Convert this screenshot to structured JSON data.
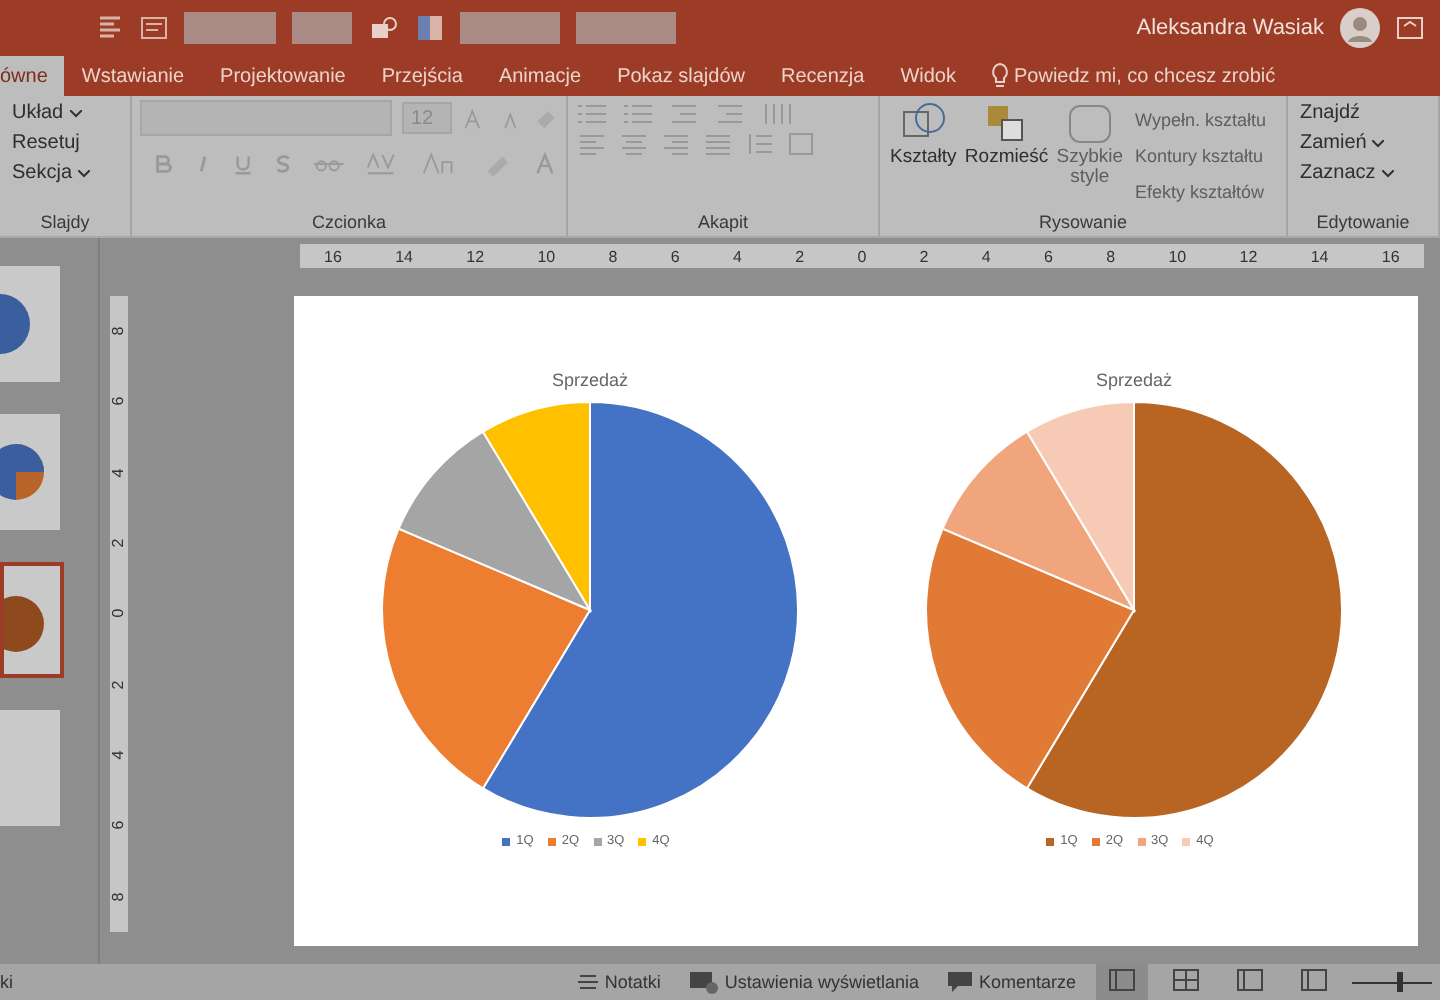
{
  "title_bar": {
    "user": "Aleksandra Wasiak"
  },
  "tabs": [
    {
      "label": "ówne",
      "selected": true
    },
    {
      "label": "Wstawianie",
      "selected": false
    },
    {
      "label": "Projektowanie",
      "selected": false
    },
    {
      "label": "Przejścia",
      "selected": false
    },
    {
      "label": "Animacje",
      "selected": false
    },
    {
      "label": "Pokaz slajdów",
      "selected": false
    },
    {
      "label": "Recenzja",
      "selected": false
    },
    {
      "label": "Widok",
      "selected": false
    }
  ],
  "tell_me": {
    "placeholder": "Powiedz mi, co chcesz zrobić"
  },
  "ribbon": {
    "slides": {
      "items": [
        {
          "label": "Układ",
          "caret": true
        },
        {
          "label": "Resetuj",
          "caret": false
        },
        {
          "label": "Sekcja",
          "caret": true
        }
      ],
      "label": "Slajdy"
    },
    "font": {
      "size": "12",
      "label": "Czcionka"
    },
    "paragraph": {
      "label": "Akapit"
    },
    "drawing": {
      "big": [
        {
          "label": "Kształty",
          "disabled": false
        },
        {
          "label": "Rozmieść",
          "disabled": false
        },
        {
          "label": "Szybkie style",
          "disabled": true
        }
      ],
      "small": [
        {
          "label": "Wypełn. kształtu",
          "disabled": true
        },
        {
          "label": "Kontury kształtu",
          "disabled": true
        },
        {
          "label": "Efekty kształtów",
          "disabled": true
        }
      ],
      "label": "Rysowanie"
    },
    "editing": {
      "items": [
        {
          "label": "Znajdź",
          "caret": false
        },
        {
          "label": "Zamień",
          "caret": true
        },
        {
          "label": "Zaznacz",
          "caret": true
        }
      ],
      "label": "Edytowanie"
    }
  },
  "ruler": {
    "horizontal": [
      "16",
      "14",
      "12",
      "10",
      "8",
      "6",
      "4",
      "2",
      "0",
      "2",
      "4",
      "6",
      "8",
      "10",
      "12",
      "14",
      "16"
    ],
    "vertical": [
      "8",
      "6",
      "4",
      "2",
      "0",
      "2",
      "4",
      "6",
      "8"
    ]
  },
  "thumbnails": [
    {
      "kind": "blue",
      "selected": false
    },
    {
      "kind": "half",
      "selected": false
    },
    {
      "kind": "brown",
      "selected": true
    },
    {
      "kind": "blank",
      "selected": false
    }
  ],
  "charts": [
    {
      "chart_data": {
        "type": "pie",
        "title": "Sprzedaż",
        "legend": "bottom",
        "categories": [
          "1Q",
          "2Q",
          "3Q",
          "4Q"
        ],
        "colors": [
          "#4472c4",
          "#ed7d31",
          "#a5a5a5",
          "#ffc000"
        ],
        "series": [
          {
            "values": [
              58.6,
              22.8,
              10,
              8.6
            ]
          }
        ]
      }
    },
    {
      "chart_data": {
        "type": "pie",
        "title": "Sprzedaż",
        "legend": "bottom",
        "categories": [
          "1Q",
          "2Q",
          "3Q",
          "4Q"
        ],
        "colors": [
          "#b86523",
          "#e07a34",
          "#f0a57c",
          "#f6cab5"
        ],
        "series": [
          {
            "values": [
              58.6,
              22.8,
              10,
              8.6
            ]
          }
        ]
      }
    }
  ],
  "status_bar": {
    "left_text": "ki",
    "buttons": [
      {
        "kind": "notes",
        "label": "Notatki"
      },
      {
        "kind": "display",
        "label": "Ustawienia wyświetlania"
      },
      {
        "kind": "comments",
        "label": "Komentarze"
      }
    ],
    "views": [
      {
        "selected": true
      },
      {
        "selected": false
      },
      {
        "selected": false
      },
      {
        "selected": false
      }
    ],
    "zoom": {
      "level": 0.6
    }
  }
}
